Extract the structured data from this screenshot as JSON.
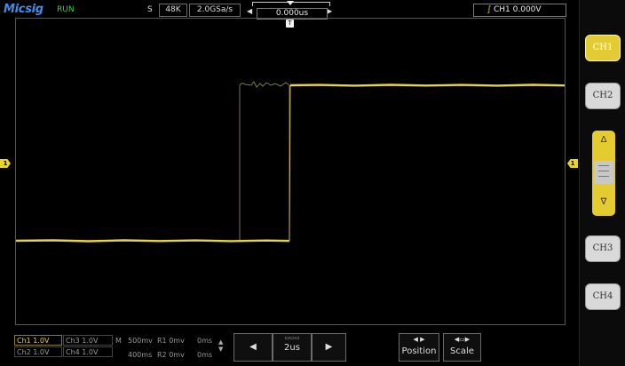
{
  "header": {
    "brand": "Micsig",
    "run_state": "RUN",
    "sample_label": "S",
    "memory_depth": "48K",
    "sample_rate": "2.0GSa/s",
    "horizontal_position": "0.000us",
    "trigger": {
      "source_level": "CH1 0.000V"
    }
  },
  "markers": {
    "trigger_time": "T",
    "ch1_left": "1",
    "ch1_right": "1"
  },
  "channels": {
    "ch1": "CH1",
    "ch2": "CH2",
    "ch3": "CH3",
    "ch4": "CH4",
    "up_arrow": "Δ",
    "down_arrow": "∇"
  },
  "status": {
    "ch1": "Ch1 1.0V",
    "ch2": "Ch2 1.0V",
    "ch3": "Ch3 1.0V",
    "ch4": "Ch4 1.0V",
    "m_label": "M",
    "m_scale": "500mv",
    "m_time": "400ms",
    "r1": "R1 0mv",
    "r1_time": "0ms",
    "r2": "R2 0mv",
    "r2_time": "0ms"
  },
  "controls": {
    "timebase": "2us",
    "position": "Position",
    "scale": "Scale"
  },
  "colors": {
    "ch1": "#e9d42e",
    "trace": "#e6d34a",
    "brand": "#3f8fe8",
    "run": "#2fd14a"
  }
}
